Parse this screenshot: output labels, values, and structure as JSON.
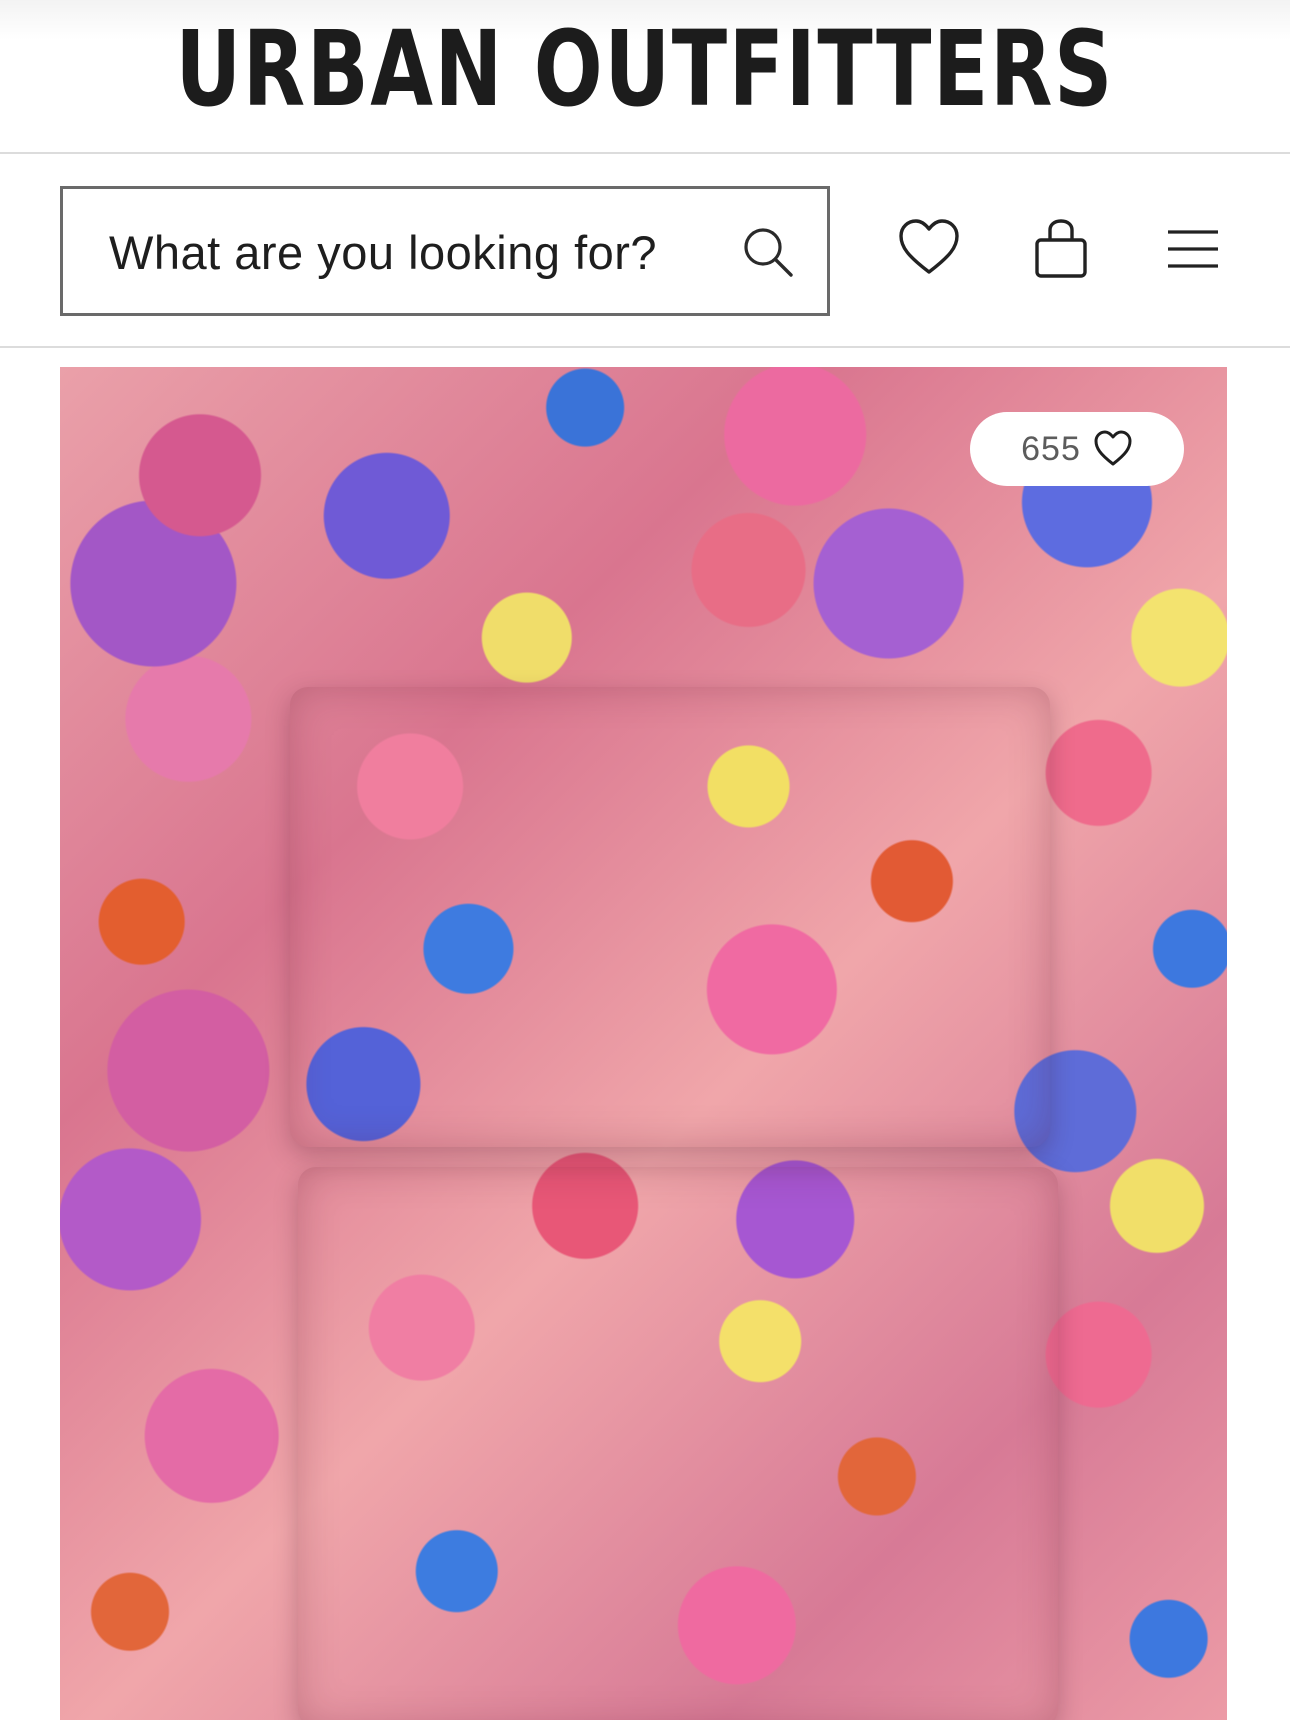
{
  "header": {
    "logo": "URBAN OUTFITTERS"
  },
  "navbar": {
    "search_placeholder": "What are you looking for?",
    "icons": [
      "search-icon",
      "heart-icon",
      "shopping-bag-icon",
      "hamburger-menu-icon"
    ]
  },
  "product": {
    "image_description_icon": "floral-sheet-set-image",
    "likes": "655",
    "like_icon": "heart-icon"
  },
  "colors": {
    "text": "#1c1c1c",
    "border": "#6a6a6a",
    "divider": "#dcdcdc",
    "pill_bg": "#ffffff"
  }
}
